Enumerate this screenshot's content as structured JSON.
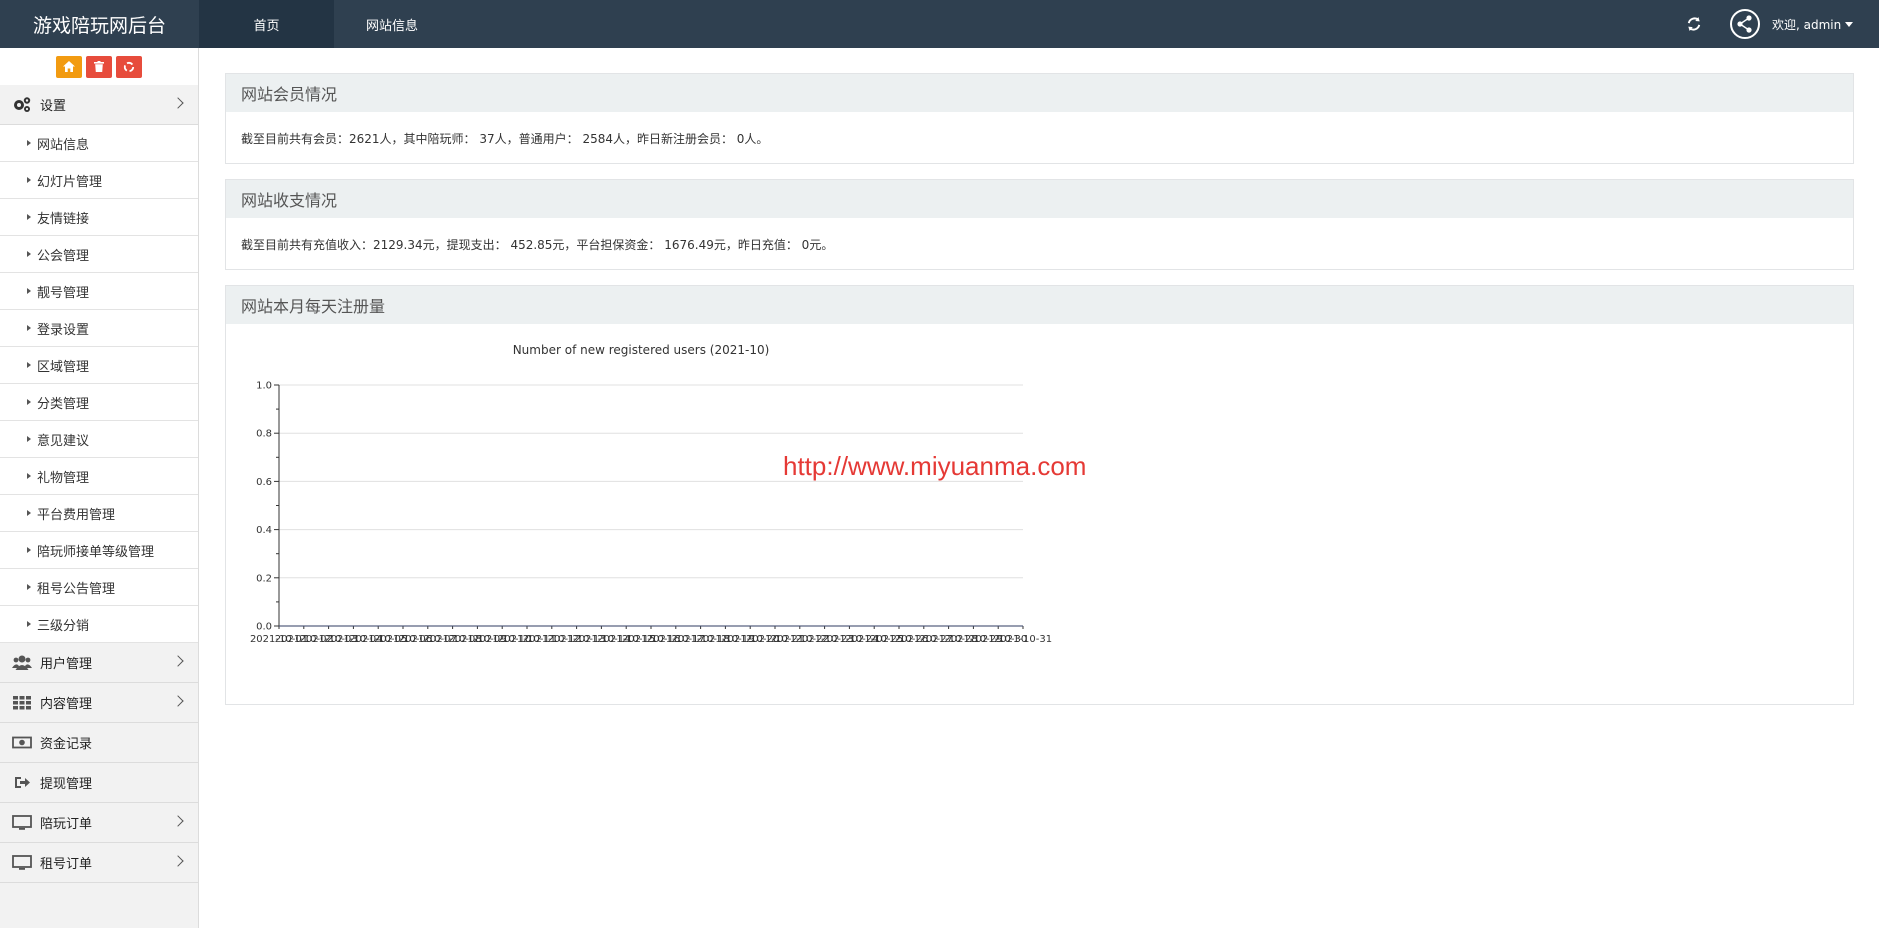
{
  "app": {
    "brand": "游戏陪玩网后台"
  },
  "topnav": {
    "tabs": [
      {
        "label": "首页",
        "active": true
      },
      {
        "label": "网站信息",
        "active": false
      }
    ]
  },
  "header": {
    "refresh_icon": "refresh-icon",
    "avatar_icon": "share-avatar-icon",
    "welcome": "欢迎, admin"
  },
  "quick_buttons": [
    {
      "icon": "home-icon",
      "color": "#f29b11"
    },
    {
      "icon": "trash-icon",
      "color": "#e74c3c"
    },
    {
      "icon": "recycle-icon",
      "color": "#e74c3c"
    }
  ],
  "sidebar": {
    "settings": {
      "label": "设置",
      "icon": "gears-icon",
      "items": [
        "网站信息",
        "幻灯片管理",
        "友情链接",
        "公会管理",
        "靓号管理",
        "登录设置",
        "区域管理",
        "分类管理",
        "意见建议",
        "礼物管理",
        "平台费用管理",
        "陪玩师接单等级管理",
        "租号公告管理",
        "三级分销"
      ]
    },
    "groups": [
      {
        "label": "用户管理",
        "icon": "users-icon",
        "has_arrow": true
      },
      {
        "label": "内容管理",
        "icon": "grid-icon",
        "has_arrow": true
      },
      {
        "label": "资金记录",
        "icon": "money-icon",
        "has_arrow": false
      },
      {
        "label": "提现管理",
        "icon": "sign-out-icon",
        "has_arrow": false
      },
      {
        "label": "陪玩订单",
        "icon": "monitor-icon",
        "has_arrow": true
      },
      {
        "label": "租号订单",
        "icon": "monitor-icon",
        "has_arrow": true
      }
    ]
  },
  "panels": {
    "members": {
      "title": "网站会员情况",
      "text": "截至目前共有会员：2621人，其中陪玩师： 37人，普通用户： 2584人，昨日新注册会员： 0人。"
    },
    "finance": {
      "title": "网站收支情况",
      "text": "截至目前共有充值收入：2129.34元，提现支出： 452.85元，平台担保资金： 1676.49元，昨日充值： 0元。"
    },
    "registrations": {
      "title": "网站本月每天注册量"
    }
  },
  "chart_data": {
    "type": "line",
    "title": "Number of new registered users (2021-10)",
    "x": [
      "2021-10-01",
      "2021-10-02",
      "2021-10-03",
      "2021-10-04",
      "2021-10-05",
      "2021-10-06",
      "2021-10-07",
      "2021-10-08",
      "2021-10-09",
      "2021-10-10",
      "2021-10-11",
      "2021-10-12",
      "2021-10-13",
      "2021-10-14",
      "2021-10-15",
      "2021-10-16",
      "2021-10-17",
      "2021-10-18",
      "2021-10-19",
      "2021-10-20",
      "2021-10-21",
      "2021-10-22",
      "2021-10-23",
      "2021-10-24",
      "2021-10-25",
      "2021-10-26",
      "2021-10-27",
      "2021-10-28",
      "2021-10-29",
      "2021-10-30",
      "2021-10-31"
    ],
    "series": [
      {
        "values": [
          0,
          0,
          0,
          0,
          0,
          0,
          0,
          0,
          0,
          0,
          0,
          0,
          0,
          0,
          0,
          0,
          0,
          0,
          0,
          0,
          0,
          0,
          0,
          0,
          0,
          0,
          0,
          0,
          0,
          0,
          0
        ]
      }
    ],
    "ylim": [
      0,
      1.0
    ],
    "yticks": [
      "0.0",
      "0.2",
      "0.4",
      "0.6",
      "0.8",
      "1.0"
    ],
    "grid": true,
    "xlabel": "",
    "ylabel": ""
  },
  "watermark": "http://www.miyuanma.com"
}
